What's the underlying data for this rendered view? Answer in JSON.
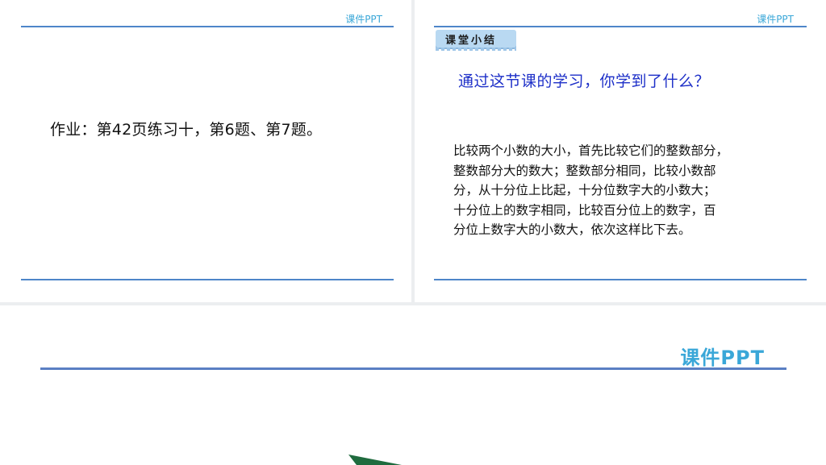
{
  "slides": {
    "homework": {
      "brand": "课件PPT",
      "text": "作业：第42页练习十，第6题、第7题。"
    },
    "summary": {
      "brand": "课件PPT",
      "tag": "课堂小结",
      "question": "通过这节课的学习，你学到了什么？",
      "lines": [
        "比较两个小数的大小，首先比较它们的整数部分，",
        "整数部分大的数大；整数部分相同，比较小数部",
        "分，从十分位上比起，十分位数字大的小数大；",
        "十分位上的数字相同，比较百分位上的数字，百",
        "分位上数字大的小数大，依次这样比下去。"
      ]
    },
    "title_slide": {
      "brand": "课件PPT"
    }
  },
  "colors": {
    "brand": "#3aa7d8",
    "rule": "#4e86c9",
    "question": "#1d2fc8",
    "tag_bg": "#b9d9f2",
    "triangle": "#1f6b3e"
  }
}
